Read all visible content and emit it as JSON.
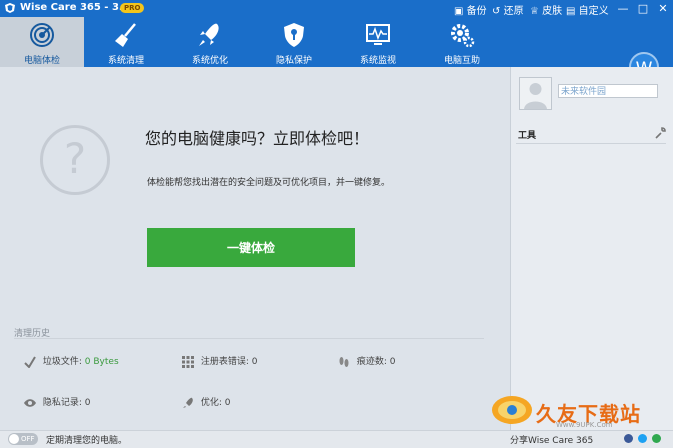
{
  "app": {
    "title": "Wise Care 365 - 3.4.3",
    "badge": "PRO",
    "menu": {
      "backup": "备份",
      "restore": "还原",
      "skin": "皮肤",
      "custom": "自定义"
    },
    "window_buttons": {
      "minimize": "—",
      "maximize": "□",
      "close": "✕"
    }
  },
  "nav": {
    "items": [
      {
        "label": "电脑体检",
        "icon": "radar-icon",
        "active": true
      },
      {
        "label": "系统清理",
        "icon": "broom-icon",
        "active": false
      },
      {
        "label": "系统优化",
        "icon": "rocket-icon",
        "active": false
      },
      {
        "label": "隐私保护",
        "icon": "shield-icon",
        "active": false
      },
      {
        "label": "系统监视",
        "icon": "monitor-icon",
        "active": false
      },
      {
        "label": "电脑互助",
        "icon": "gear-icon",
        "active": false
      }
    ],
    "account_letter": "W"
  },
  "main": {
    "headline": "您的电脑健康吗？立即体检吧！",
    "description": "体检能帮您找出潜在的安全问题及可优化项目，并一键修复。",
    "check_button": "一键体检",
    "history": {
      "title": "清理历史",
      "items": [
        {
          "label": "垃圾文件:",
          "value": "0 Bytes",
          "icon": "broom-icon"
        },
        {
          "label": "注册表错误:",
          "value": "0",
          "icon": "grid-icon"
        },
        {
          "label": "痕迹数:",
          "value": "0",
          "icon": "footprint-icon"
        },
        {
          "label": "隐私记录:",
          "value": "0",
          "icon": "eye-icon"
        },
        {
          "label": "优化:",
          "value": "0",
          "icon": "rocket-icon"
        }
      ]
    }
  },
  "sidebar": {
    "profile_name": "未来软件园",
    "tools_label": "工具"
  },
  "footer": {
    "toggle_text": "OFF",
    "schedule_text": "定期清理您的电脑。",
    "share_text": "分享Wise Care 365"
  },
  "watermark": {
    "text": "久友下载站",
    "url": "Www.9UPK.Com"
  },
  "colors": {
    "accent": "#1a6ec9",
    "button_green": "#39a93d",
    "background": "#dde3ea"
  }
}
